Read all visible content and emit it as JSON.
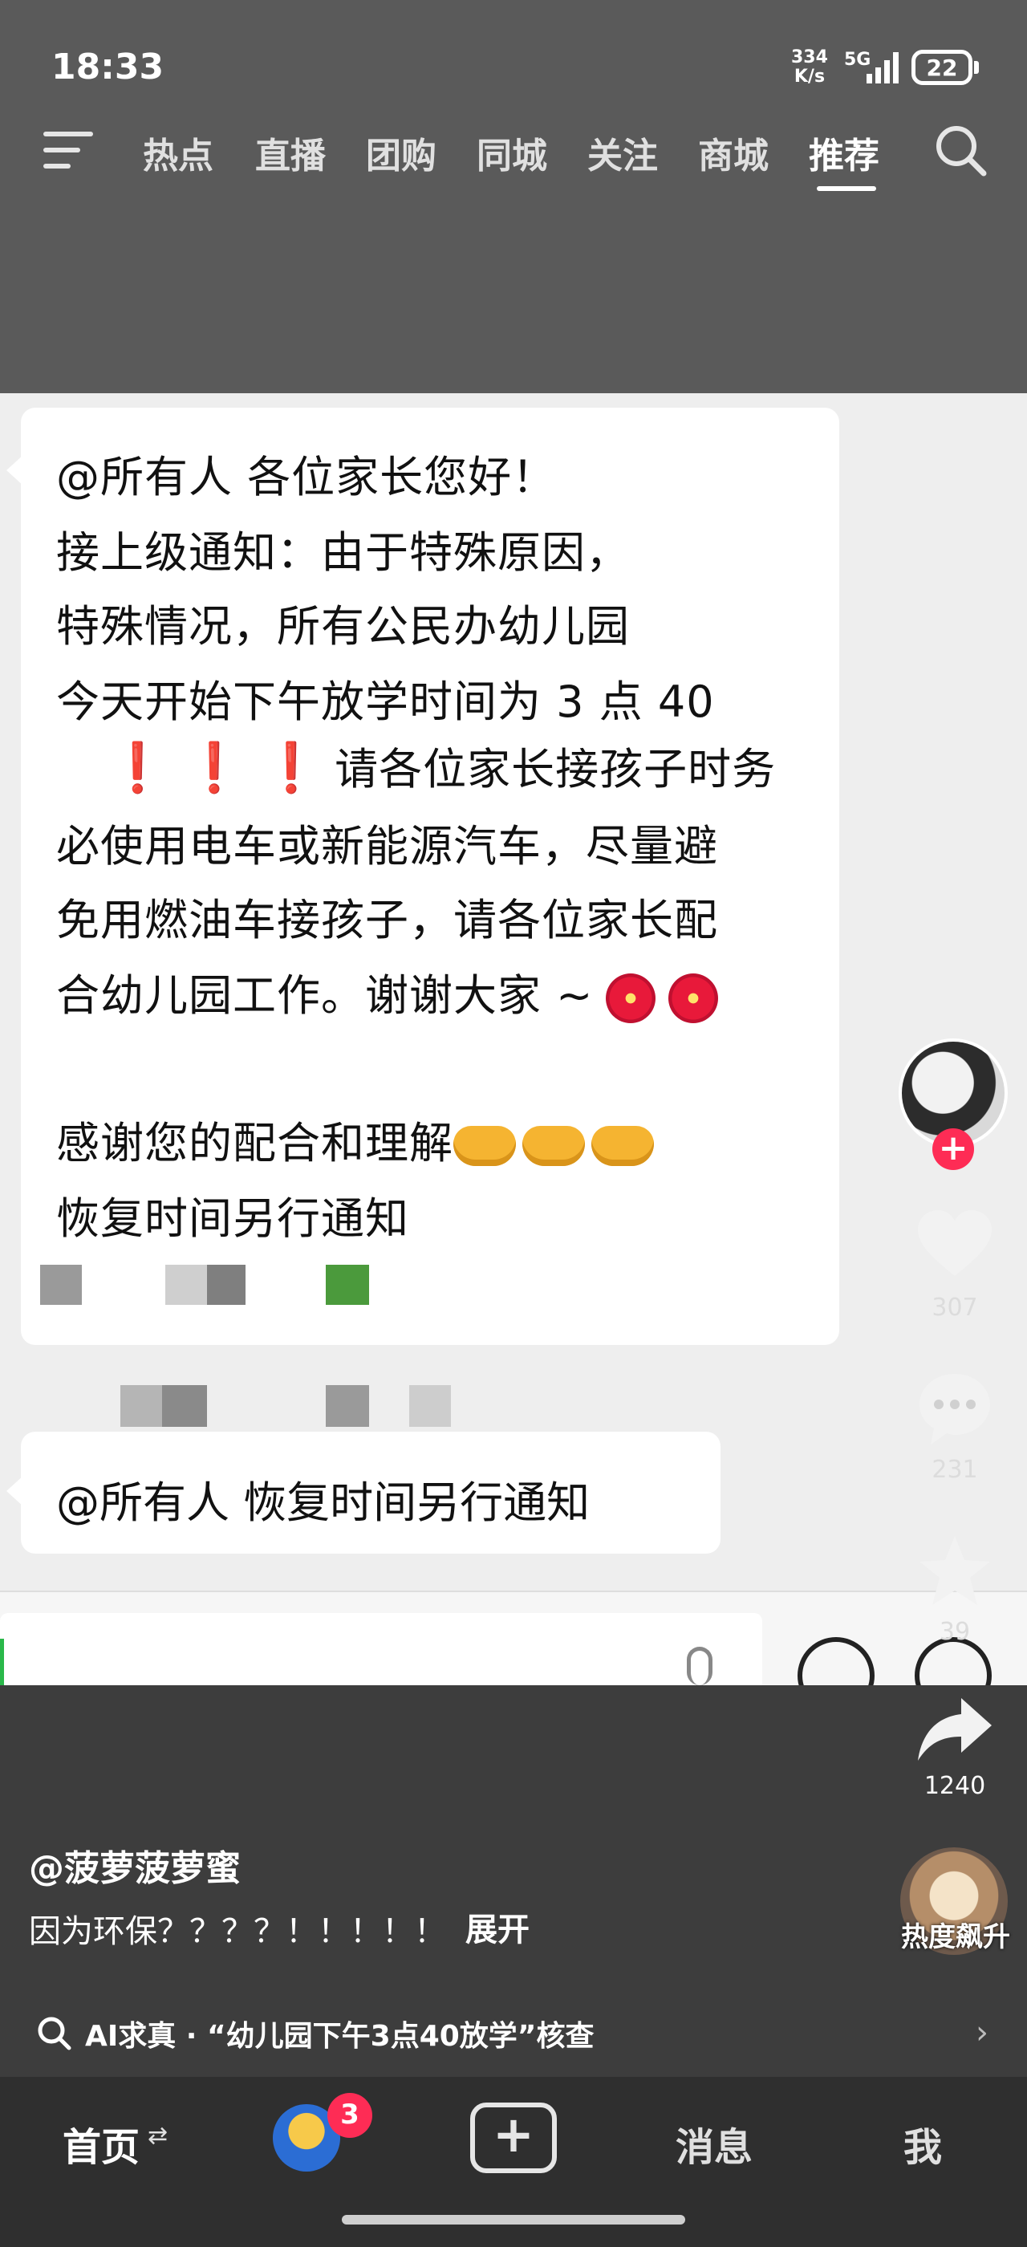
{
  "status_bar": {
    "time": "18:33",
    "net_speed_value": "334",
    "net_speed_unit": "K/s",
    "network": "5G",
    "battery": "22"
  },
  "top_nav": {
    "tabs": [
      "热点",
      "直播",
      "团购",
      "同城",
      "关注",
      "商城",
      "推荐"
    ],
    "active_tab": "推荐"
  },
  "chat": {
    "main_lines": [
      "@所有人  各位家长您好！",
      "      接上级通知：由于特殊原因，",
      "特殊情况，所有公民办幼儿园",
      "今天开始下午放学时间为 3 点 40",
      "请各位家长接孩子时务",
      "必使用电车或新能源汽车，尽量避",
      "免用燃油车接孩子，请各位家长配",
      "合幼儿园工作。谢谢大家 ~",
      "感谢您的配合和理解",
      "恢复时间另行通知"
    ],
    "exclamations": [
      "❗",
      "❗",
      "❗"
    ],
    "second_message": "@所有人  恢复时间另行通知"
  },
  "actions": {
    "like_count": "307",
    "comment_count": "231",
    "favorite_count": "39",
    "share_count": "1240"
  },
  "post": {
    "author": "@菠萝菠萝蜜",
    "caption": "因为环保？？？？！！！！！",
    "expand": "展开",
    "heat_label": "热度飙升"
  },
  "ai_check": {
    "text": "AI求真 · “幼儿园下午3点40放学”核查"
  },
  "bottom_tabs": {
    "home": "首页",
    "friends_badge": "3",
    "create": "+",
    "messages": "消息",
    "me": "我"
  },
  "colors": {
    "like_red": "#fe2c55",
    "chat_bg": "#eeeeee",
    "panel_dark": "#3d3d3d"
  }
}
